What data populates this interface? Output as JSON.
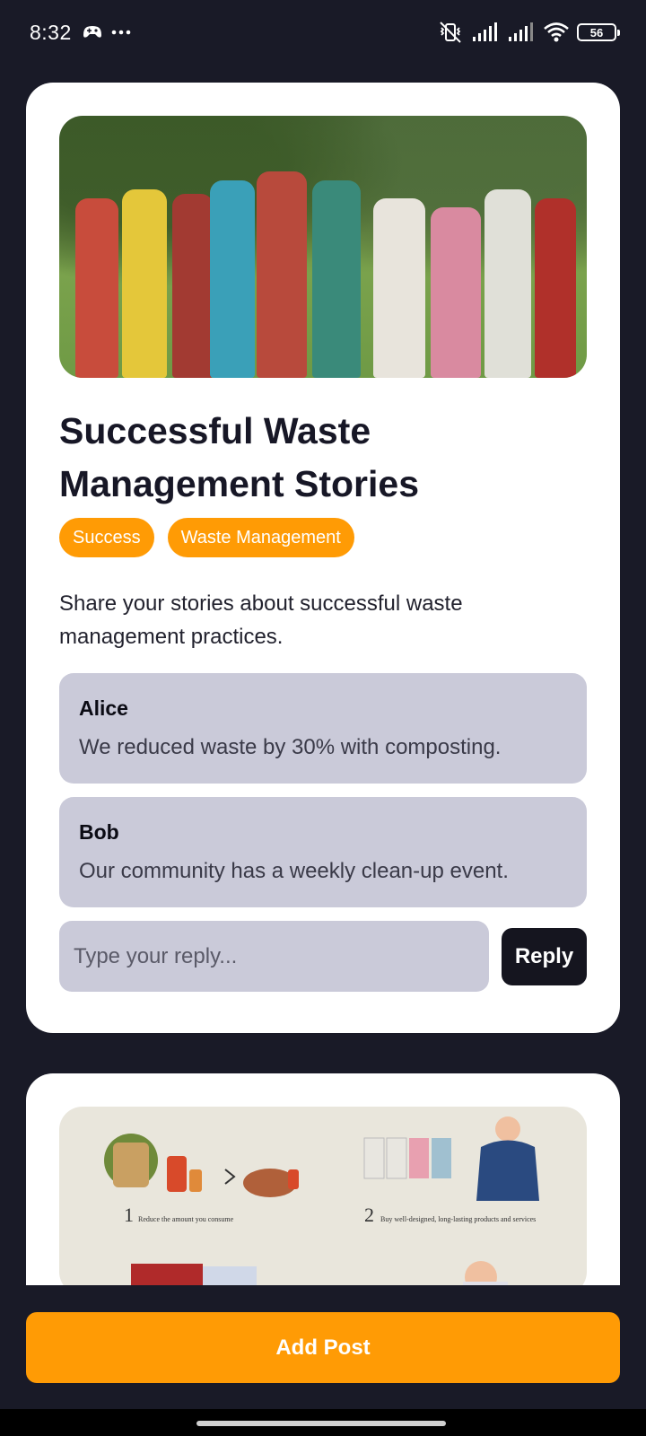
{
  "status_bar": {
    "time": "8:32",
    "battery": "56"
  },
  "posts": [
    {
      "title": "Successful Waste Management Stories",
      "tags": [
        "Success",
        "Waste Management"
      ],
      "body": "Share your stories about successful waste management practices.",
      "replies": [
        {
          "author": "Alice",
          "text": "We reduced waste by 30% with composting."
        },
        {
          "author": "Bob",
          "text": "Our community has a weekly clean-up event."
        }
      ],
      "reply_placeholder": "Type your reply...",
      "reply_button": "Reply"
    }
  ],
  "infographic": {
    "step1": "1",
    "step1_text": "Reduce the amount you consume",
    "step2": "2",
    "step2_text": "Buy well-designed, long-lasting products and services"
  },
  "add_post_label": "Add Post",
  "colors": {
    "accent": "#ff9b05",
    "background": "#191a27",
    "reply_bg": "#cacad9",
    "button_dark": "#15151f"
  }
}
